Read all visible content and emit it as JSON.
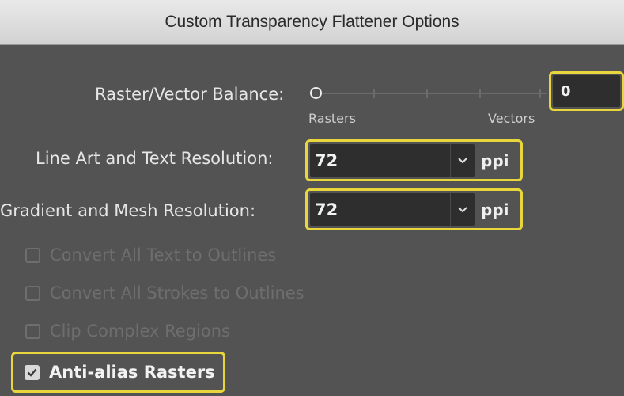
{
  "dialog": {
    "title": "Custom Transparency Flattener Options"
  },
  "raster_vector": {
    "label": "Raster/Vector Balance:",
    "left_caption": "Rasters",
    "right_caption": "Vectors",
    "value": "0",
    "slider_position_fraction": 0
  },
  "line_art": {
    "label": "Line Art and Text Resolution:",
    "value": "72",
    "unit": "ppi"
  },
  "gradient_mesh": {
    "label": "Gradient and Mesh Resolution:",
    "value": "72",
    "unit": "ppi"
  },
  "options": {
    "convert_text": {
      "label": "Convert All Text to Outlines",
      "checked": false,
      "enabled": false
    },
    "convert_strokes": {
      "label": "Convert All Strokes to Outlines",
      "checked": false,
      "enabled": false
    },
    "clip_regions": {
      "label": "Clip Complex Regions",
      "checked": false,
      "enabled": false
    },
    "anti_alias": {
      "label": "Anti-alias Rasters",
      "checked": true,
      "enabled": true
    }
  },
  "icons": {
    "dropdown": "chevron-down-icon",
    "check": "checkmark-icon"
  },
  "colors": {
    "background": "#535353",
    "highlight": "#e8d63c",
    "field_bg": "#2e2e2e",
    "disabled_text": "#6e6e6e"
  }
}
